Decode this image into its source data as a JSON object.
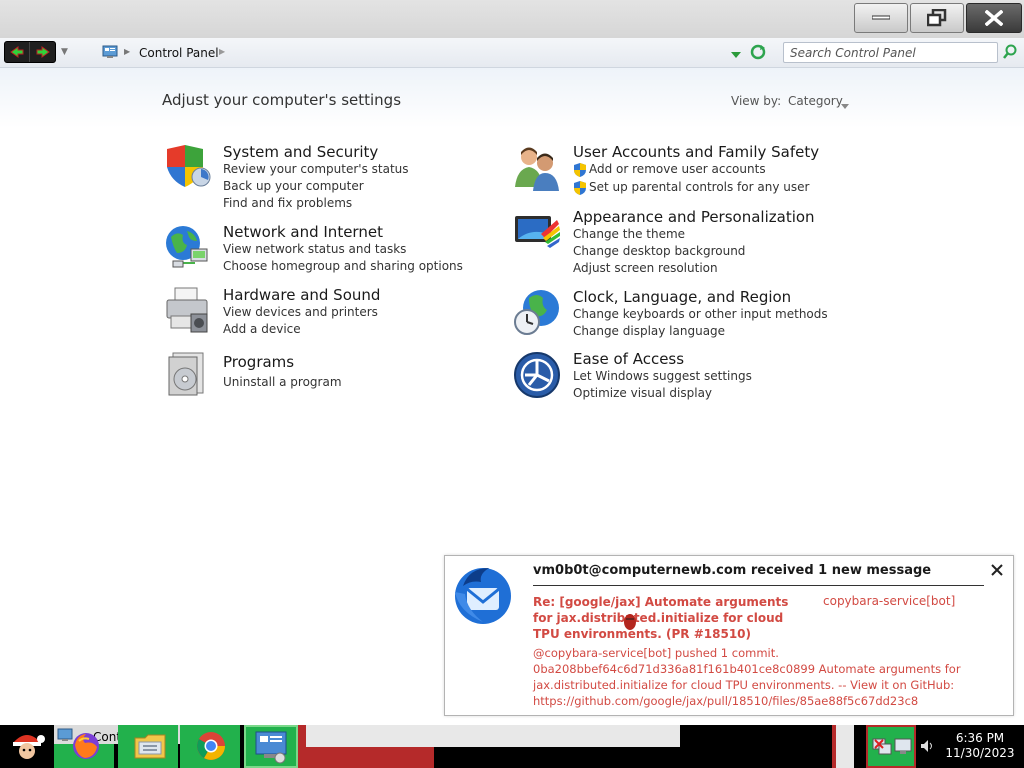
{
  "window": {
    "minimize_label": "minimize",
    "restore_label": "restore",
    "close_label": "close"
  },
  "address": {
    "location": "Control Panel",
    "search_placeholder": "Search Control Panel"
  },
  "content": {
    "heading": "Adjust your computer's settings",
    "view_by_label": "View by:",
    "view_by_value": "Category"
  },
  "categories": [
    {
      "title": "System and Security",
      "links": [
        "Review your computer's status",
        "Back up your computer",
        "Find and fix problems"
      ],
      "icon": "shield-icon"
    },
    {
      "title": "Network and Internet",
      "links": [
        "View network status and tasks",
        "Choose homegroup and sharing options"
      ],
      "icon": "network-globe-icon"
    },
    {
      "title": "Hardware and Sound",
      "links": [
        "View devices and printers",
        "Add a device"
      ],
      "icon": "printer-icon"
    },
    {
      "title": "Programs",
      "links": [
        "Uninstall a program"
      ],
      "icon": "programs-icon"
    },
    {
      "title": "User Accounts and Family Safety",
      "links": [
        "Add or remove user accounts",
        "Set up parental controls for any user"
      ],
      "icon": "users-icon"
    },
    {
      "title": "Appearance and Personalization",
      "links": [
        "Change the theme",
        "Change desktop background",
        "Adjust screen resolution"
      ],
      "icon": "monitor-palette-icon"
    },
    {
      "title": "Clock, Language, and Region",
      "links": [
        "Change keyboards or other input methods",
        "Change display language"
      ],
      "icon": "clock-globe-icon"
    },
    {
      "title": "Ease of Access",
      "links": [
        "Let Windows suggest settings",
        "Optimize visual display"
      ],
      "icon": "ease-of-access-icon"
    }
  ],
  "notification": {
    "title": "vm0b0t@computernewb.com received 1 new message",
    "subject": "Re: [google/jax] Automate arguments for jax.distributed.initialize for cloud TPU environments. (PR #18510)",
    "from": "copybara-service[bot]",
    "body_line1": "@copybara-service[bot] pushed 1 commit.",
    "body_line2": "0ba208bbef64c6d71d336a81f161b401ce8c0899 Automate arguments for jax.distributed.initialize for cloud TPU environments. -- View it on GitHub: https://github.com/google/jax/pull/18510/files/85ae88f5c67dd23c8"
  },
  "taskbar": {
    "control_panel_label": "Control P",
    "time": "6:36 PM",
    "date": "11/30/2023"
  },
  "colors": {
    "notif_text": "#d24a43",
    "taskbar_green": "#22b14c",
    "taskbar_red": "#b52a2a"
  }
}
